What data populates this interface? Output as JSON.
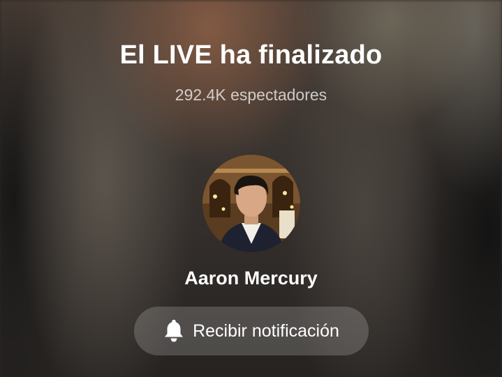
{
  "live_end": {
    "title": "El LIVE ha finalizado",
    "viewers": "292.4K espectadores"
  },
  "host": {
    "name": "Aaron Mercury"
  },
  "notify_button": {
    "label": "Recibir notificación",
    "icon": "bell-icon"
  }
}
